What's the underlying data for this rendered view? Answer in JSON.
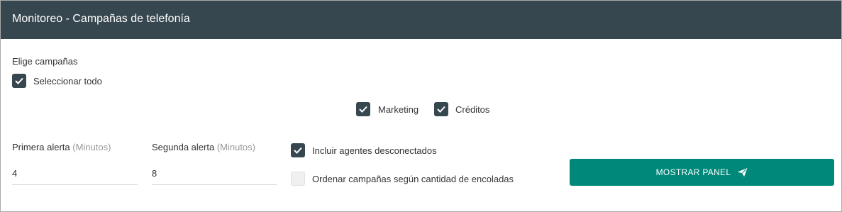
{
  "header": {
    "title": "Monitoreo - Campañas de telefonía"
  },
  "campaigns": {
    "section_label": "Elige campañas",
    "select_all_label": "Seleccionar todo",
    "items": [
      {
        "label": "Marketing",
        "checked": true
      },
      {
        "label": "Créditos",
        "checked": true
      }
    ]
  },
  "alerts": {
    "first": {
      "label": "Primera alerta",
      "unit": "(Minutos)",
      "value": "4"
    },
    "second": {
      "label": "Segunda alerta",
      "unit": "(Minutos)",
      "value": "8"
    }
  },
  "options": {
    "include_disconnected": {
      "label": "Incluir agentes desconectados",
      "checked": true
    },
    "order_by_queue": {
      "label": "Ordenar campañas según cantidad de encoladas",
      "checked": false
    }
  },
  "actions": {
    "show_panel_label": "MOSTRAR PANEL",
    "show_panel_icon": "send-icon"
  },
  "colors": {
    "header_bg": "#37474f",
    "checkbox_checked": "#37474f",
    "primary_button": "#00897b"
  }
}
